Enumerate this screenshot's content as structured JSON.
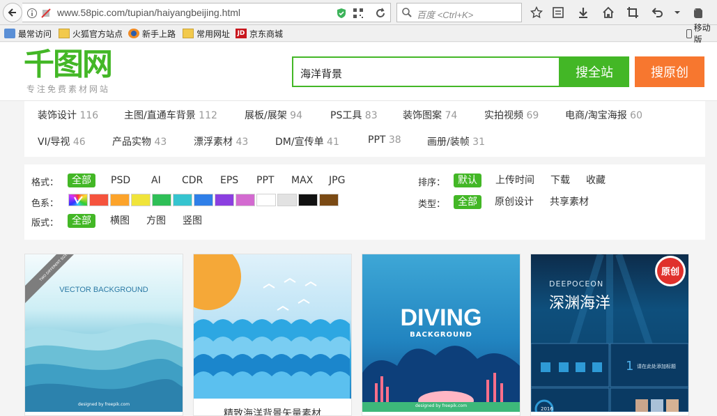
{
  "browser": {
    "url": "www.58pic.com/tupian/haiyangbeijing.html",
    "search_placeholder": "百度 <Ctrl+K>",
    "bookmarks": [
      "最常访问",
      "火狐官方站点",
      "新手上路",
      "常用网址",
      "京东商城",
      "移动版"
    ]
  },
  "site": {
    "logo": "千图网",
    "slogan": "专注免费素材网站",
    "search_value": "海洋背景",
    "search_all_label": "搜全站",
    "search_original_label": "搜原创"
  },
  "categories": [
    {
      "name": "装饰设计",
      "count": "116"
    },
    {
      "name": "主图/直通车背景",
      "count": "112"
    },
    {
      "name": "展板/展架",
      "count": "94"
    },
    {
      "name": "PS工具",
      "count": "83"
    },
    {
      "name": "装饰图案",
      "count": "74"
    },
    {
      "name": "实拍视频",
      "count": "69"
    },
    {
      "name": "电商/淘宝海报",
      "count": "60"
    },
    {
      "name": "VI/导视",
      "count": "46"
    },
    {
      "name": "产品实物",
      "count": "43"
    },
    {
      "name": "漂浮素材",
      "count": "43"
    },
    {
      "name": "DM/宣传单",
      "count": "41"
    },
    {
      "name": "PPT",
      "count": "38"
    },
    {
      "name": "画册/装帧",
      "count": "31"
    }
  ],
  "filters": {
    "format_label": "格式：",
    "formats": [
      "全部",
      "PSD",
      "AI",
      "CDR",
      "EPS",
      "PPT",
      "MAX",
      "JPG"
    ],
    "color_label": "色系：",
    "colors": [
      "#f5533d",
      "#fca32b",
      "#f0e43a",
      "#2fbf57",
      "#36c4cf",
      "#2f7fe8",
      "#8b3fe0",
      "#d36ad0",
      "#ffffff",
      "#e2e2e2",
      "#111111",
      "#7a4a14"
    ],
    "layout_label": "版式：",
    "layouts": [
      "全部",
      "横图",
      "方图",
      "竖图"
    ],
    "sort_label": "排序：",
    "sorts": [
      "默认",
      "上传时间",
      "下载",
      "收藏"
    ],
    "type_label": "类型：",
    "types": [
      "全部",
      "原创设计",
      "共享素材"
    ]
  },
  "cards": [
    {
      "heading": "VECTOR BACKGROUND",
      "ribbon": "TWO DIFFERENT SIZE",
      "footer": "designed by freepik.com"
    },
    {
      "caption": "精致海洋背景矢量素材"
    },
    {
      "heading": "DIVING",
      "sub": "BACKGROUND",
      "footer": "designed by freepik.com"
    },
    {
      "en": "DEEPOCEON",
      "cn": "深渊海洋",
      "badge": "原创",
      "slide_num": "1",
      "slide_text": "请在此处添加标题",
      "year": "2016"
    }
  ]
}
